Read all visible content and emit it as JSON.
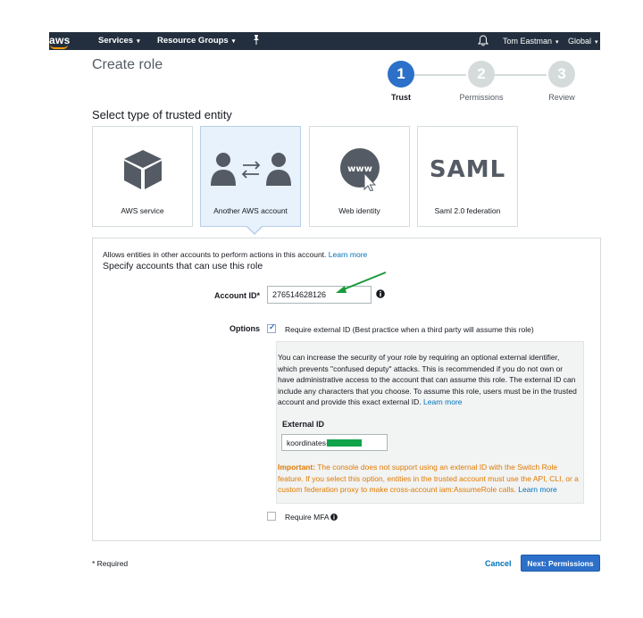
{
  "nav": {
    "logo": "aws",
    "services": "Services",
    "resource_groups": "Resource Groups",
    "user": "Tom Eastman",
    "region": "Global",
    "caret": "▾"
  },
  "page": {
    "title": "Create role"
  },
  "wizard": {
    "steps": [
      {
        "number": "1",
        "label": "Trust"
      },
      {
        "number": "2",
        "label": "Permissions"
      },
      {
        "number": "3",
        "label": "Review"
      }
    ],
    "active_step": 1
  },
  "trusted_entity": {
    "section_title": "Select type of trusted entity",
    "options": [
      {
        "label": "AWS service",
        "icon": "cube-icon"
      },
      {
        "label": "Another AWS account",
        "icon": "account-transfer-icon"
      },
      {
        "label": "Web identity",
        "icon": "www-icon"
      },
      {
        "label": "Saml 2.0 federation",
        "icon": "saml-logo",
        "logo_text": "SAML"
      }
    ],
    "selected": "Another AWS account"
  },
  "panel": {
    "description": "Allows entities in other accounts to perform actions in this account.",
    "learn_more": "Learn more",
    "subtitle": "Specify accounts that can use this role",
    "account_id_label": "Account ID*",
    "account_id_value": "276514628126",
    "options_label": "Options",
    "require_external_id_label": "Require external ID (Best practice when a third party will assume this role)",
    "require_external_id_checked": true,
    "checkmark": "✓",
    "external_info": "You can increase the security of your role by requiring an optional external identifier, which prevents \"confused deputy\" attacks. This is recommended if you do not own or have administrative access to the account that can assume this role. The external ID can include any characters that you choose. To assume this role, users must be in the trusted account and provide this exact external ID.",
    "external_info_link": "Learn more",
    "external_id_label": "External ID",
    "external_id_value": "koordinates-",
    "important_label": "Important:",
    "important_text": " The console does not support using an external ID with the Switch Role feature. If you select this option, entities in the trusted account must use the API, CLI, or a custom federation proxy to make cross-account iam:AssumeRole calls.",
    "important_link": "Learn more",
    "require_mfa_label": "Require MFA",
    "require_mfa_checked": false
  },
  "footer": {
    "required_note": "* Required",
    "cancel": "Cancel",
    "next": "Next: Permissions"
  },
  "colors": {
    "nav_bg": "#232f3e",
    "primary": "#2c70c9",
    "link": "#0073bb",
    "warning": "#e07b00",
    "annotation_arrow": "#1a9a3a",
    "redaction": "#10a34a"
  }
}
